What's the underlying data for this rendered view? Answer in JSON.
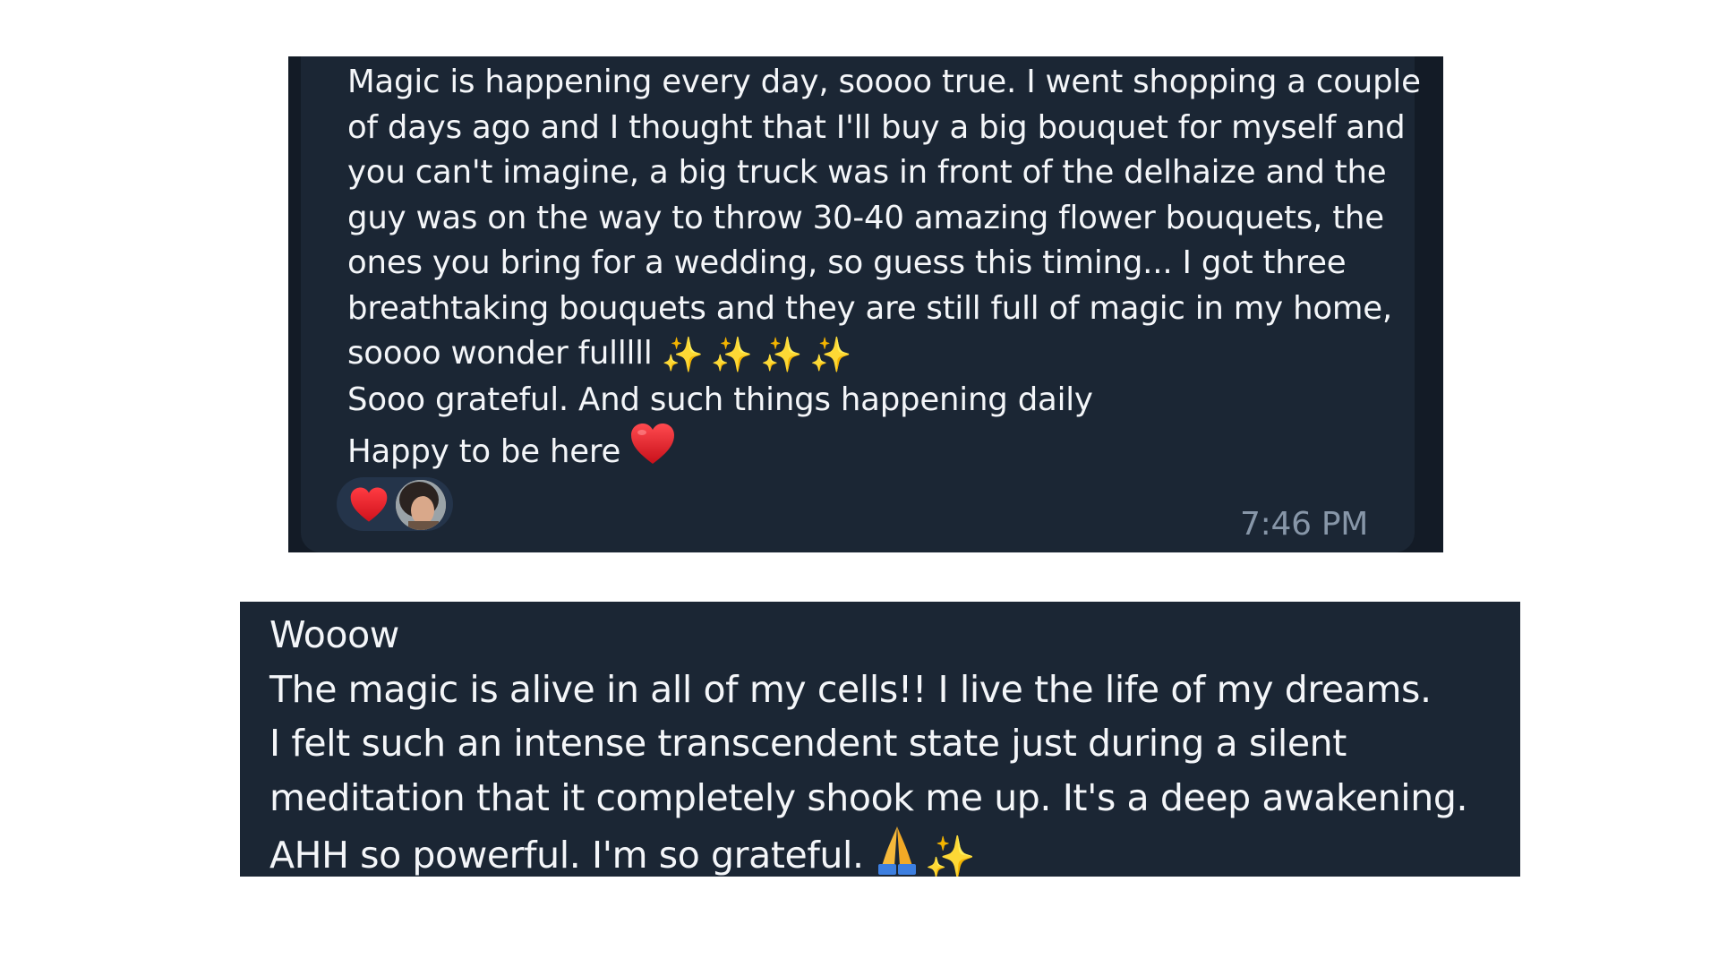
{
  "messages": [
    {
      "lines": [
        "Magic is happening every day, soooo true. I went shopping a couple",
        "of days ago and I thought that I'll buy a big bouquet for myself and",
        "you can't imagine, a big truck was in front of the delhaize and the",
        "guy was on the way to throw 30-40 amazing flower bouquets, the",
        "ones you bring for a wedding, so guess this timing... I got three",
        "breathtaking bouquets and they are still full of magic in my home,",
        "soooo wonder fulllll",
        "Sooo grateful. And such things happening daily",
        "Happy to be here"
      ],
      "sparkles": "✨✨✨✨",
      "end_emoji": "heart-emoji",
      "reactions": [
        "heart-icon",
        "avatar"
      ],
      "time": "7:46 PM"
    },
    {
      "lines": [
        "Wooow",
        "The magic is alive in all of my cells!! I live the life of my dreams.",
        "I felt such an intense transcendent state just during a silent",
        "meditation that it completely shook me up. It's a deep awakening.",
        "AHH so powerful. I'm so grateful."
      ],
      "end_emojis": [
        "praying-hands-emoji",
        "sparkles-emoji"
      ],
      "sparkle": "✨"
    }
  ],
  "colors": {
    "bubble": "#1b2634",
    "background": "#131b26",
    "text": "#f4f6f9",
    "time": "#8796a8",
    "heart": "#e2232b",
    "sparkle": "#f7c948"
  }
}
